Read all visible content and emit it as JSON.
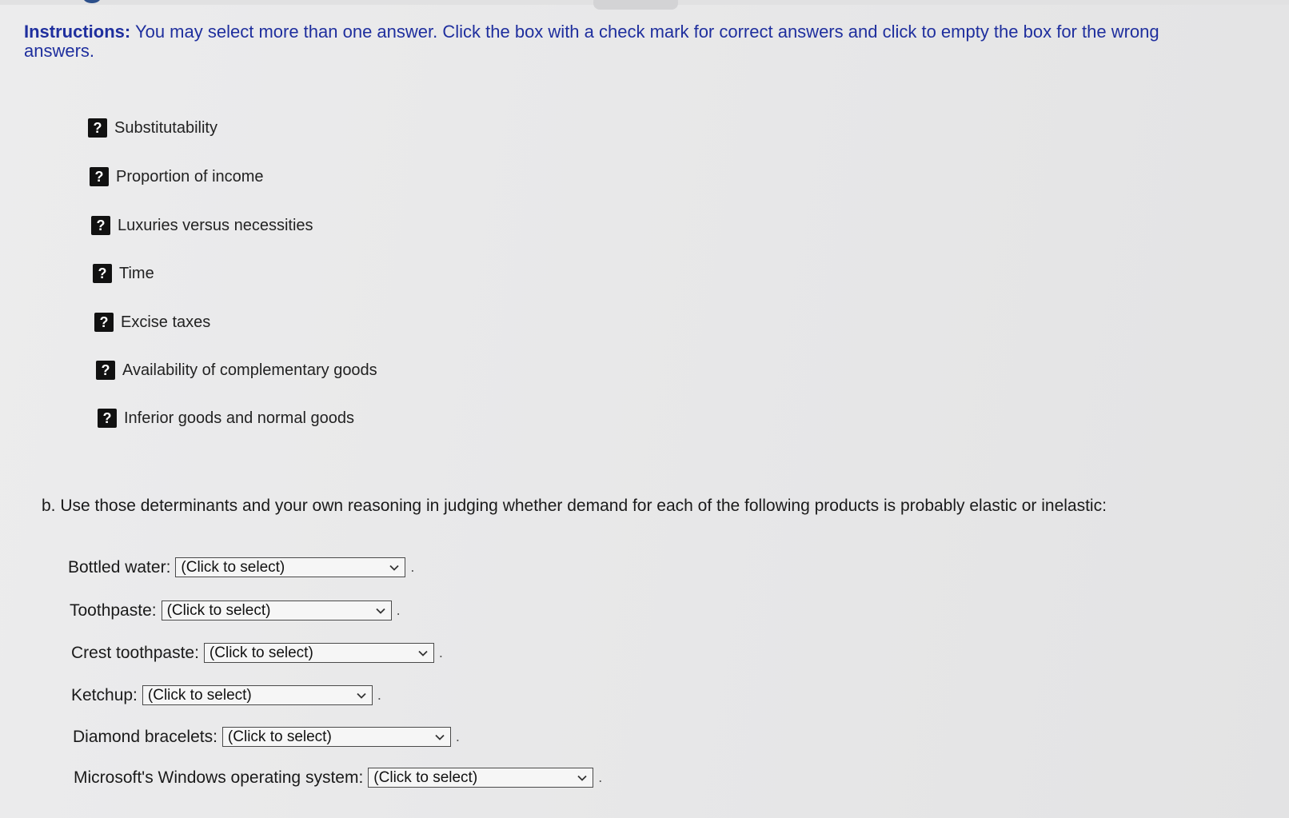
{
  "instructions": {
    "label": "Instructions:",
    "text": " You may select more than one answer. Click the box with a check mark for correct answers and click to empty the box for the wrong answers."
  },
  "options": [
    {
      "icon": "question-mark-icon",
      "label": "Substitutability"
    },
    {
      "icon": "question-mark-icon",
      "label": "Proportion of income"
    },
    {
      "icon": "question-mark-icon",
      "label": "Luxuries versus necessities"
    },
    {
      "icon": "question-mark-icon",
      "label": "Time"
    },
    {
      "icon": "question-mark-icon",
      "label": "Excise taxes"
    },
    {
      "icon": "question-mark-icon",
      "label": "Availability of complementary goods"
    },
    {
      "icon": "question-mark-icon",
      "label": "Inferior goods and normal goods"
    }
  ],
  "box_glyph": "?",
  "part_b": {
    "prompt": "b. Use those determinants and your own reasoning in judging whether demand for each of the following products is probably elastic or inelastic:",
    "items": [
      {
        "label": "Bottled water:",
        "selected": "(Click to select)"
      },
      {
        "label": "Toothpaste:",
        "selected": "(Click to select)"
      },
      {
        "label": "Crest toothpaste:",
        "selected": "(Click to select)"
      },
      {
        "label": "Ketchup:",
        "selected": "(Click to select)"
      },
      {
        "label": "Diamond bracelets:",
        "selected": "(Click to select)"
      },
      {
        "label": "Microsoft's Windows operating system:",
        "selected": "(Click to select)"
      }
    ],
    "trailing_punct": "."
  }
}
